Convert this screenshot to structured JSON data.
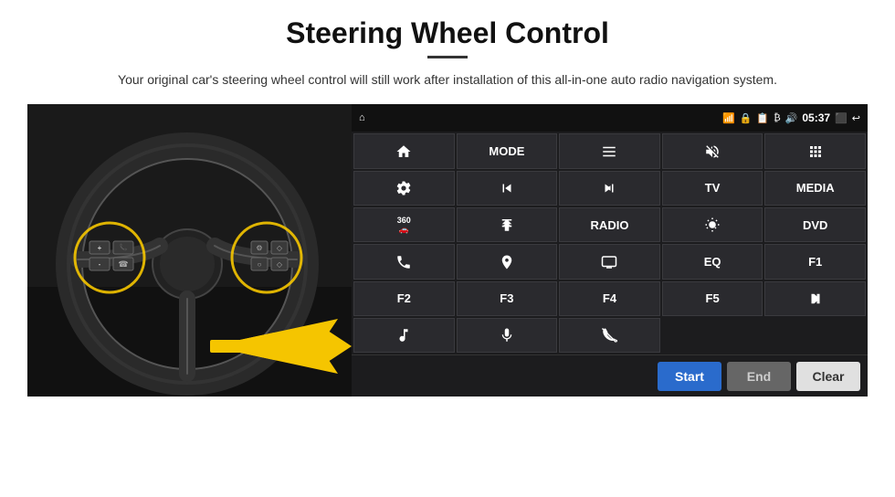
{
  "page": {
    "title": "Steering Wheel Control",
    "subtitle": "Your original car's steering wheel control will still work after installation of this all-in-one auto radio navigation system."
  },
  "statusBar": {
    "time": "05:37",
    "icons": [
      "wifi",
      "lock",
      "sim",
      "bluetooth",
      "volume",
      "cast",
      "back"
    ]
  },
  "buttons": [
    {
      "id": "r1c1",
      "type": "icon",
      "label": "home",
      "icon": "home"
    },
    {
      "id": "r1c2",
      "type": "text",
      "label": "MODE"
    },
    {
      "id": "r1c3",
      "type": "icon",
      "label": "list",
      "icon": "list"
    },
    {
      "id": "r1c4",
      "type": "icon",
      "label": "mute",
      "icon": "mute"
    },
    {
      "id": "r1c5",
      "type": "icon",
      "label": "apps",
      "icon": "apps"
    },
    {
      "id": "r2c1",
      "type": "icon",
      "label": "settings",
      "icon": "settings"
    },
    {
      "id": "r2c2",
      "type": "icon",
      "label": "prev",
      "icon": "prev"
    },
    {
      "id": "r2c3",
      "type": "icon",
      "label": "next",
      "icon": "next"
    },
    {
      "id": "r2c4",
      "type": "text",
      "label": "TV"
    },
    {
      "id": "r2c5",
      "type": "text",
      "label": "MEDIA"
    },
    {
      "id": "r3c1",
      "type": "icon",
      "label": "360cam",
      "icon": "360"
    },
    {
      "id": "r3c2",
      "type": "icon",
      "label": "eject",
      "icon": "eject"
    },
    {
      "id": "r3c3",
      "type": "text",
      "label": "RADIO"
    },
    {
      "id": "r3c4",
      "type": "icon",
      "label": "brightness",
      "icon": "brightness"
    },
    {
      "id": "r3c5",
      "type": "text",
      "label": "DVD"
    },
    {
      "id": "r4c1",
      "type": "icon",
      "label": "phone",
      "icon": "phone"
    },
    {
      "id": "r4c2",
      "type": "icon",
      "label": "navi",
      "icon": "navi"
    },
    {
      "id": "r4c3",
      "type": "icon",
      "label": "screen",
      "icon": "screen"
    },
    {
      "id": "r4c4",
      "type": "text",
      "label": "EQ"
    },
    {
      "id": "r4c5",
      "type": "text",
      "label": "F1"
    },
    {
      "id": "r5c1",
      "type": "text",
      "label": "F2"
    },
    {
      "id": "r5c2",
      "type": "text",
      "label": "F3"
    },
    {
      "id": "r5c3",
      "type": "text",
      "label": "F4"
    },
    {
      "id": "r5c4",
      "type": "text",
      "label": "F5"
    },
    {
      "id": "r5c5",
      "type": "icon",
      "label": "playpause",
      "icon": "playpause"
    },
    {
      "id": "r6c1",
      "type": "icon",
      "label": "music",
      "icon": "music"
    },
    {
      "id": "r6c2",
      "type": "icon",
      "label": "mic",
      "icon": "mic"
    },
    {
      "id": "r6c3",
      "type": "icon",
      "label": "hangup",
      "icon": "hangup"
    },
    {
      "id": "r6c4",
      "type": "empty",
      "label": ""
    },
    {
      "id": "r6c5",
      "type": "empty",
      "label": ""
    }
  ],
  "bottomBar": {
    "startLabel": "Start",
    "endLabel": "End",
    "clearLabel": "Clear"
  }
}
